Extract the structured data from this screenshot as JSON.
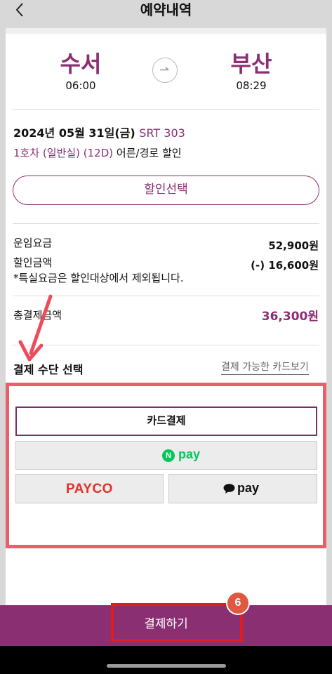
{
  "header": {
    "title": "예약내역",
    "back_icon": "chevron-left-icon"
  },
  "route": {
    "departure": {
      "station": "수서",
      "time": "06:00"
    },
    "arrival": {
      "station": "부산",
      "time": "08:29"
    },
    "swap_icon": "arrow-right-circle-icon"
  },
  "train": {
    "date": "2024년 05월 31일(금)",
    "code": "SRT 303",
    "seat": "1호차 (일반실) (12D)",
    "passenger": "어른/경로 할인"
  },
  "discount_button": "할인선택",
  "fare": {
    "base_label": "운임요금",
    "base_value": "52,900원",
    "discount_label": "할인금액",
    "discount_value": "(-) 16,600원",
    "note": "*특실요금은 할인대상에서 제외됩니다.",
    "total_label": "총결제금액",
    "total_value": "36,300원"
  },
  "payment": {
    "section_title": "결제 수단 선택",
    "card_list_link": "결제 가능한 카드보기",
    "card_button": "카드결제",
    "npay_mark": "N",
    "npay_label": "pay",
    "payco_label": "PAYCO",
    "kakao_label": "pay"
  },
  "submit_button": "결제하기",
  "annotation": {
    "step_number": "6",
    "highlight_color": "#e8606a",
    "submit_outline_color": "#e21b1b",
    "badge_color": "#e0583f"
  },
  "colors": {
    "brand": "#8b2f72",
    "bottom_bar": "#8a2f72",
    "npay_green": "#03c75a",
    "payco_red": "#e3302b"
  }
}
